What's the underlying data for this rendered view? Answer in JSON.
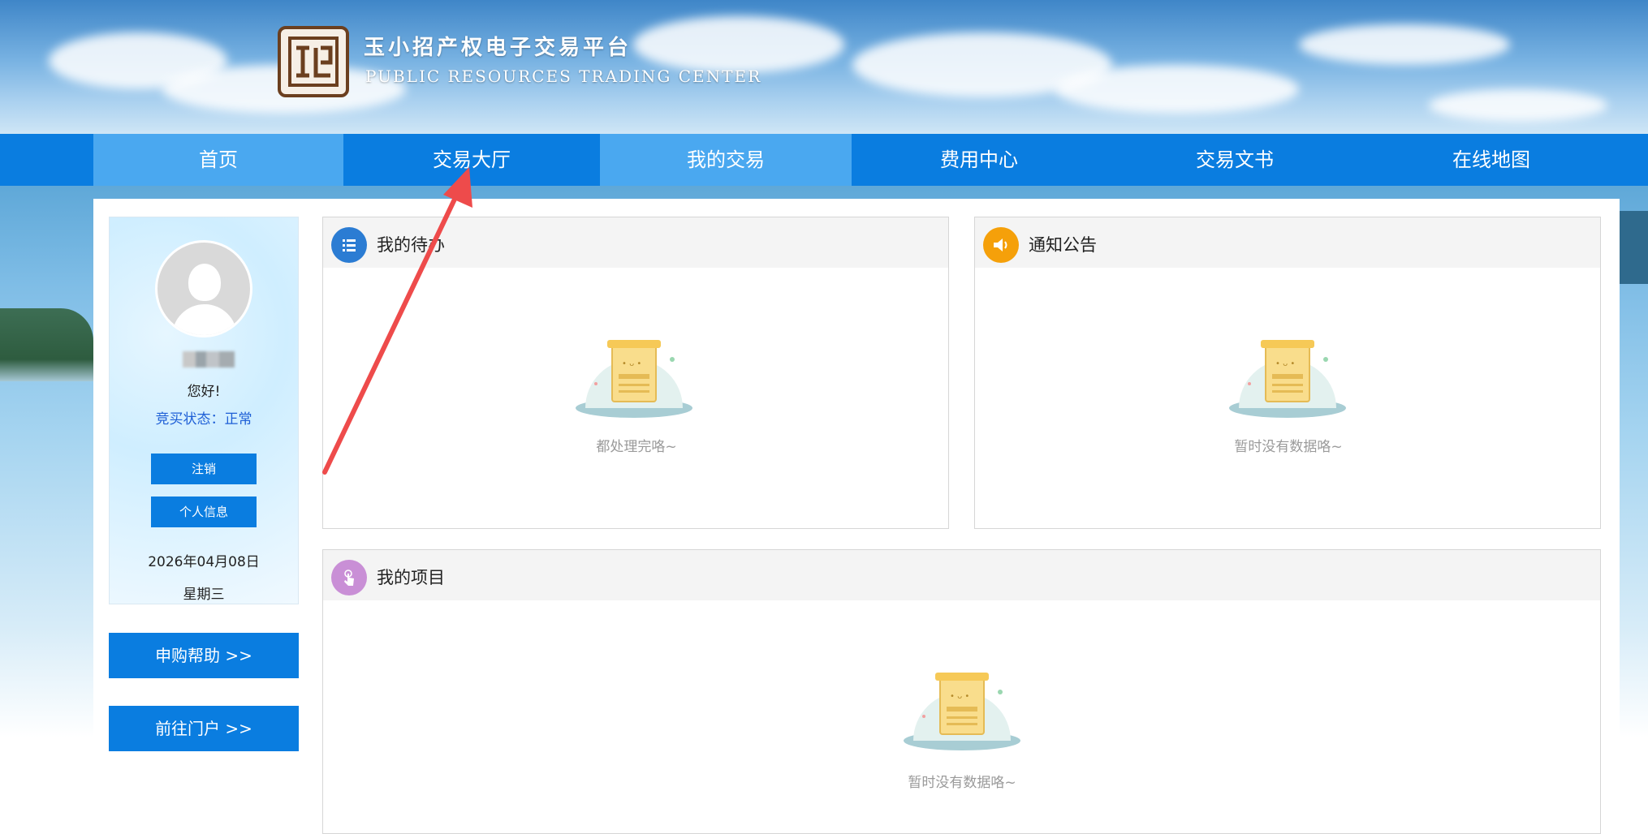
{
  "header": {
    "title_cn": "玉小招产权电子交易平台",
    "title_en": "PUBLIC RESOURCES TRADING CENTER"
  },
  "nav": {
    "items": [
      {
        "label": "首页"
      },
      {
        "label": "交易大厅"
      },
      {
        "label": "我的交易"
      },
      {
        "label": "费用中心"
      },
      {
        "label": "交易文书"
      },
      {
        "label": "在线地图"
      }
    ]
  },
  "user": {
    "greeting": "您好!",
    "status": "竞买状态：正常",
    "logout_label": "注销",
    "profile_label": "个人信息",
    "date": "2026年04月08日",
    "weekday": "星期三"
  },
  "sidebar": {
    "help_label": "申购帮助 >>",
    "portal_label": "前往门户 >>"
  },
  "panels": {
    "todo": {
      "title": "我的待办",
      "empty": "都处理完咯~"
    },
    "notice": {
      "title": "通知公告",
      "empty": "暂时没有数据咯~"
    },
    "projects": {
      "title": "我的项目",
      "empty": "暂时没有数据咯~"
    }
  },
  "colors": {
    "nav_blue": "#0a7de0",
    "nav_active": "#4aa8f0",
    "todo_icon": "#2b7cd3",
    "notice_icon": "#f5a00a",
    "project_icon": "#c98fd6",
    "annotation_arrow": "#ee4b4b"
  }
}
